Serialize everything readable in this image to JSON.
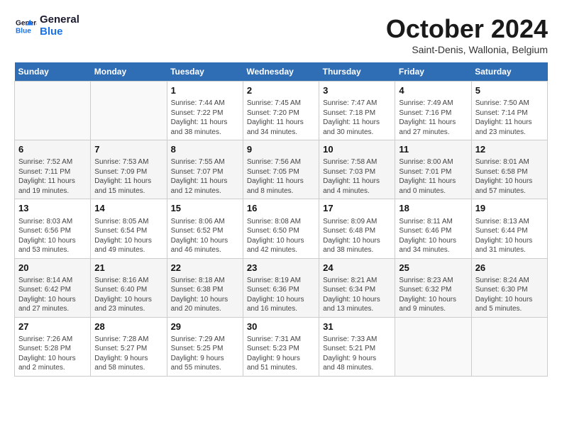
{
  "logo": {
    "line1": "General",
    "line2": "Blue"
  },
  "title": "October 2024",
  "location": "Saint-Denis, Wallonia, Belgium",
  "days_of_week": [
    "Sunday",
    "Monday",
    "Tuesday",
    "Wednesday",
    "Thursday",
    "Friday",
    "Saturday"
  ],
  "weeks": [
    [
      {
        "day": "",
        "info": ""
      },
      {
        "day": "",
        "info": ""
      },
      {
        "day": "1",
        "info": "Sunrise: 7:44 AM\nSunset: 7:22 PM\nDaylight: 11 hours\nand 38 minutes."
      },
      {
        "day": "2",
        "info": "Sunrise: 7:45 AM\nSunset: 7:20 PM\nDaylight: 11 hours\nand 34 minutes."
      },
      {
        "day": "3",
        "info": "Sunrise: 7:47 AM\nSunset: 7:18 PM\nDaylight: 11 hours\nand 30 minutes."
      },
      {
        "day": "4",
        "info": "Sunrise: 7:49 AM\nSunset: 7:16 PM\nDaylight: 11 hours\nand 27 minutes."
      },
      {
        "day": "5",
        "info": "Sunrise: 7:50 AM\nSunset: 7:14 PM\nDaylight: 11 hours\nand 23 minutes."
      }
    ],
    [
      {
        "day": "6",
        "info": "Sunrise: 7:52 AM\nSunset: 7:11 PM\nDaylight: 11 hours\nand 19 minutes."
      },
      {
        "day": "7",
        "info": "Sunrise: 7:53 AM\nSunset: 7:09 PM\nDaylight: 11 hours\nand 15 minutes."
      },
      {
        "day": "8",
        "info": "Sunrise: 7:55 AM\nSunset: 7:07 PM\nDaylight: 11 hours\nand 12 minutes."
      },
      {
        "day": "9",
        "info": "Sunrise: 7:56 AM\nSunset: 7:05 PM\nDaylight: 11 hours\nand 8 minutes."
      },
      {
        "day": "10",
        "info": "Sunrise: 7:58 AM\nSunset: 7:03 PM\nDaylight: 11 hours\nand 4 minutes."
      },
      {
        "day": "11",
        "info": "Sunrise: 8:00 AM\nSunset: 7:01 PM\nDaylight: 11 hours\nand 0 minutes."
      },
      {
        "day": "12",
        "info": "Sunrise: 8:01 AM\nSunset: 6:58 PM\nDaylight: 10 hours\nand 57 minutes."
      }
    ],
    [
      {
        "day": "13",
        "info": "Sunrise: 8:03 AM\nSunset: 6:56 PM\nDaylight: 10 hours\nand 53 minutes."
      },
      {
        "day": "14",
        "info": "Sunrise: 8:05 AM\nSunset: 6:54 PM\nDaylight: 10 hours\nand 49 minutes."
      },
      {
        "day": "15",
        "info": "Sunrise: 8:06 AM\nSunset: 6:52 PM\nDaylight: 10 hours\nand 46 minutes."
      },
      {
        "day": "16",
        "info": "Sunrise: 8:08 AM\nSunset: 6:50 PM\nDaylight: 10 hours\nand 42 minutes."
      },
      {
        "day": "17",
        "info": "Sunrise: 8:09 AM\nSunset: 6:48 PM\nDaylight: 10 hours\nand 38 minutes."
      },
      {
        "day": "18",
        "info": "Sunrise: 8:11 AM\nSunset: 6:46 PM\nDaylight: 10 hours\nand 34 minutes."
      },
      {
        "day": "19",
        "info": "Sunrise: 8:13 AM\nSunset: 6:44 PM\nDaylight: 10 hours\nand 31 minutes."
      }
    ],
    [
      {
        "day": "20",
        "info": "Sunrise: 8:14 AM\nSunset: 6:42 PM\nDaylight: 10 hours\nand 27 minutes."
      },
      {
        "day": "21",
        "info": "Sunrise: 8:16 AM\nSunset: 6:40 PM\nDaylight: 10 hours\nand 23 minutes."
      },
      {
        "day": "22",
        "info": "Sunrise: 8:18 AM\nSunset: 6:38 PM\nDaylight: 10 hours\nand 20 minutes."
      },
      {
        "day": "23",
        "info": "Sunrise: 8:19 AM\nSunset: 6:36 PM\nDaylight: 10 hours\nand 16 minutes."
      },
      {
        "day": "24",
        "info": "Sunrise: 8:21 AM\nSunset: 6:34 PM\nDaylight: 10 hours\nand 13 minutes."
      },
      {
        "day": "25",
        "info": "Sunrise: 8:23 AM\nSunset: 6:32 PM\nDaylight: 10 hours\nand 9 minutes."
      },
      {
        "day": "26",
        "info": "Sunrise: 8:24 AM\nSunset: 6:30 PM\nDaylight: 10 hours\nand 5 minutes."
      }
    ],
    [
      {
        "day": "27",
        "info": "Sunrise: 7:26 AM\nSunset: 5:28 PM\nDaylight: 10 hours\nand 2 minutes."
      },
      {
        "day": "28",
        "info": "Sunrise: 7:28 AM\nSunset: 5:27 PM\nDaylight: 9 hours\nand 58 minutes."
      },
      {
        "day": "29",
        "info": "Sunrise: 7:29 AM\nSunset: 5:25 PM\nDaylight: 9 hours\nand 55 minutes."
      },
      {
        "day": "30",
        "info": "Sunrise: 7:31 AM\nSunset: 5:23 PM\nDaylight: 9 hours\nand 51 minutes."
      },
      {
        "day": "31",
        "info": "Sunrise: 7:33 AM\nSunset: 5:21 PM\nDaylight: 9 hours\nand 48 minutes."
      },
      {
        "day": "",
        "info": ""
      },
      {
        "day": "",
        "info": ""
      }
    ]
  ]
}
